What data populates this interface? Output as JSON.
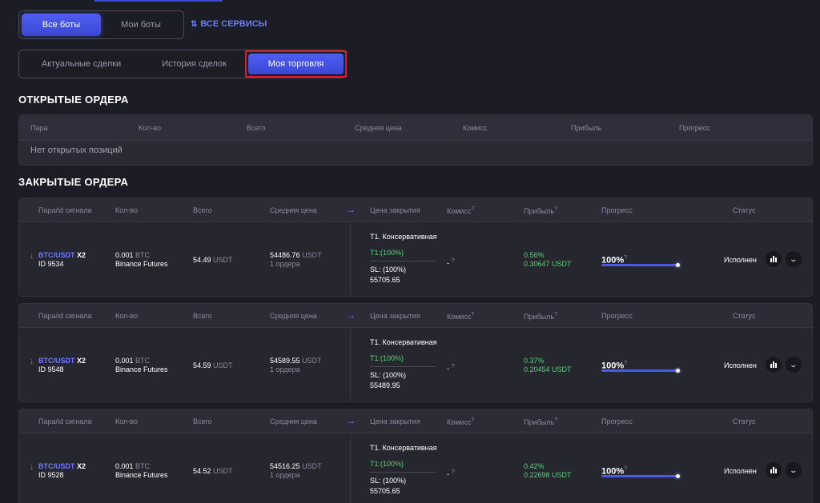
{
  "top_tabs": {
    "all_bots": "Все боты",
    "my_bots": "Мои боты"
  },
  "services_link": {
    "label": "ВСЕ СЕРВИСЫ",
    "icon": "swap-vertical-icon"
  },
  "trade_tabs": {
    "current": "Актуальные сделки",
    "history": "История сделок",
    "my_trading": "Моя торговля",
    "active": "my_trading"
  },
  "open_orders": {
    "title": "ОТКРЫТЫЕ ОРДЕРА",
    "columns": [
      "Пара",
      "Кол-во",
      "Всего",
      "Средняя цена",
      "Комисс",
      "Прибыль",
      "Прогресс"
    ],
    "empty_text": "Нет открытых позиций"
  },
  "closed_orders": {
    "title": "ЗАКРЫТЫЕ ОРДЕРА",
    "columns": {
      "pair": "Пара/id сигнала",
      "qty": "Кол-во",
      "total": "Всего",
      "avg": "Средняя цена",
      "close_price": "Цена закрытия",
      "fee": "Комисс",
      "fee_q": "?",
      "profit": "Прибыль",
      "profit_q": "?",
      "progress": "Прогресс",
      "status": "Статус"
    },
    "rows": [
      {
        "pair": "BTC/USDT",
        "leverage": "X2",
        "id": "ID 9534",
        "qty": "0.001",
        "qty_unit": "BTC",
        "exchange": "Binance Futures",
        "total": "54.49",
        "total_unit": "USDT",
        "avg": "54486.76",
        "avg_unit": "USDT",
        "orders": "1 ордера",
        "strategy": "T1. Консервативная",
        "tp": "T1:(100%)",
        "sl": "SL: (100%)",
        "sl_price": "55705.65",
        "fee": "-",
        "fee_q": "?",
        "profit_pct": "0.56%",
        "profit_usdt": "0.30647 USDT",
        "progress": "100%",
        "progress_q": "?",
        "progress_value": 1.0,
        "status": "Исполнен"
      },
      {
        "pair": "BTC/USDT",
        "leverage": "X2",
        "id": "ID 9548",
        "qty": "0.001",
        "qty_unit": "BTC",
        "exchange": "Binance Futures",
        "total": "54.59",
        "total_unit": "USDT",
        "avg": "54589.55",
        "avg_unit": "USDT",
        "orders": "1 ордера",
        "strategy": "T1. Консервативная",
        "tp": "T1:(100%)",
        "sl": "SL: (100%)",
        "sl_price": "55489.95",
        "fee": "-",
        "fee_q": "?",
        "profit_pct": "0.37%",
        "profit_usdt": "0.20454 USDT",
        "progress": "100%",
        "progress_q": "?",
        "progress_value": 1.0,
        "status": "Исполнен"
      },
      {
        "pair": "BTC/USDT",
        "leverage": "X2",
        "id": "ID 9528",
        "qty": "0.001",
        "qty_unit": "BTC",
        "exchange": "Binance Futures",
        "total": "54.52",
        "total_unit": "USDT",
        "avg": "54516.25",
        "avg_unit": "USDT",
        "orders": "1 ордера",
        "strategy": "T1. Консервативная",
        "tp": "T1:(100%)",
        "sl": "SL: (100%)",
        "sl_price": "55705.65",
        "fee": "-",
        "fee_q": "?",
        "profit_pct": "0.42%",
        "profit_usdt": "0.22698 USDT",
        "progress": "100%",
        "progress_q": "?",
        "progress_value": 1.0,
        "status": "Исполнен"
      }
    ]
  },
  "colors": {
    "accent": "#4f5ef0",
    "profit": "#5fcf7b",
    "down_arrow": "#e25a4a",
    "highlight_border": "#e0192b"
  }
}
